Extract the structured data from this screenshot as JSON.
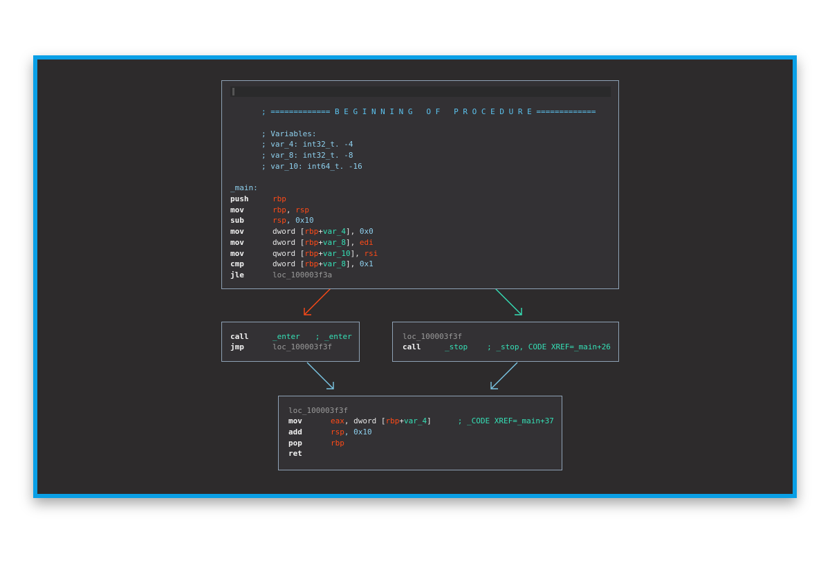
{
  "colors": {
    "frame_border": "#0a9fe6",
    "canvas": "#2d2b2c",
    "register": "#ff4a17",
    "variable": "#35e0b6",
    "number": "#8ed0ee",
    "edge_false": "#ff4a17",
    "edge_true": "#35e0b6",
    "edge_plain": "#7cc8e6"
  },
  "main_block": {
    "header": "; ============= B E G I N N I N G   O F   P R O C E D U R E =============",
    "vars_title": "; Variables:",
    "vars": [
      "; var_4: int32_t. -4",
      "; var_8: int32_t. -8",
      "; var_10: int64_t. -16"
    ],
    "label": "_main:",
    "ins": [
      {
        "mn": "push",
        "a1": "rbp"
      },
      {
        "mn": "mov",
        "a1": "rbp",
        ",": ", ",
        "a2": "rsp"
      },
      {
        "mn": "sub",
        "a1": "rsp",
        "a2": ", 0x10"
      },
      {
        "mn": "mov",
        "pre": "dword [",
        "reg": "rbp",
        "plus": "+",
        "var": "var_4",
        "post": "], ",
        "imm": "0x0"
      },
      {
        "mn": "mov",
        "pre": "dword [",
        "reg": "rbp",
        "plus": "+",
        "var": "var_8",
        "post": "], ",
        "r2": "edi"
      },
      {
        "mn": "mov",
        "pre": "qword [",
        "reg": "rbp",
        "plus": "+",
        "var": "var_10",
        "post": "], ",
        "r2": "rsi"
      },
      {
        "mn": "cmp",
        "pre": "dword [",
        "reg": "rbp",
        "plus": "+",
        "var": "var_8",
        "post": "], ",
        "imm": "0x1"
      },
      {
        "mn": "jle",
        "loc": "loc_100003f3a"
      }
    ]
  },
  "left_block": {
    "ins": [
      {
        "mn": "call",
        "sym": "_enter",
        "cmt": "; _enter"
      },
      {
        "mn": "jmp",
        "loc": "loc_100003f3f"
      }
    ]
  },
  "right_block": {
    "label": "loc_100003f3f",
    "ins": [
      {
        "mn": "call",
        "sym": "_stop",
        "cmt": "; _stop, CODE XREF=_main+26"
      }
    ]
  },
  "bottom_block": {
    "label": "loc_100003f3f",
    "ins": [
      {
        "mn": "mov",
        "r1": "eax",
        "pre": ", dword [",
        "reg": "rbp",
        "plus": "+",
        "var": "var_4",
        "post": "]",
        "cmt": "; _CODE XREF=_main+37"
      },
      {
        "mn": "add",
        "r1": "rsp",
        "rest": ", 0x10"
      },
      {
        "mn": "pop",
        "r1": "rbp"
      },
      {
        "mn": "ret"
      }
    ]
  }
}
